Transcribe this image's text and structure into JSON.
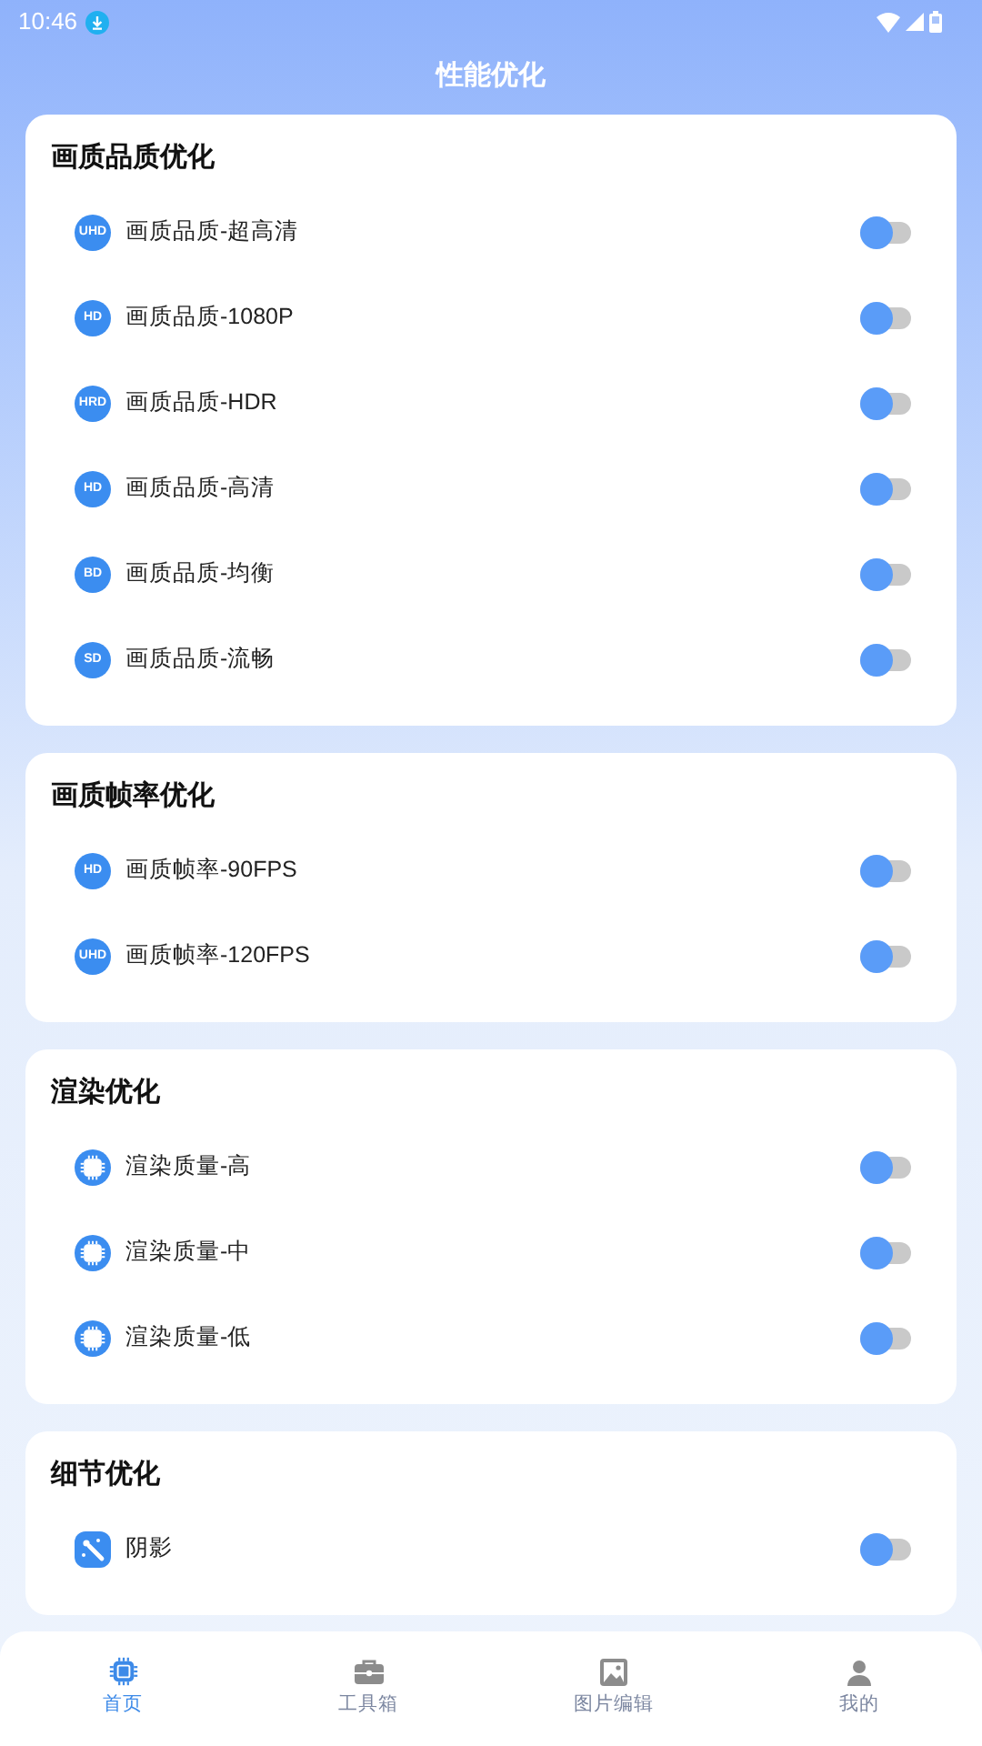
{
  "status_bar": {
    "time": "10:46"
  },
  "header": {
    "title": "性能优化"
  },
  "sections": [
    {
      "title": "画质品质优化",
      "items": [
        {
          "kind": "badge",
          "badge": "UHD",
          "label": "画质品质-超高清",
          "on": false
        },
        {
          "kind": "badge",
          "badge": "HD",
          "label": "画质品质-1080P",
          "on": false
        },
        {
          "kind": "badge",
          "badge": "HRD",
          "label": "画质品质-HDR",
          "on": false
        },
        {
          "kind": "badge",
          "badge": "HD",
          "label": "画质品质-高清",
          "on": false
        },
        {
          "kind": "badge",
          "badge": "BD",
          "label": "画质品质-均衡",
          "on": false
        },
        {
          "kind": "badge",
          "badge": "SD",
          "label": "画质品质-流畅",
          "on": false
        }
      ]
    },
    {
      "title": "画质帧率优化",
      "items": [
        {
          "kind": "badge",
          "badge": "HD",
          "label": "画质帧率-90FPS",
          "on": false
        },
        {
          "kind": "badge",
          "badge": "UHD",
          "label": "画质帧率-120FPS",
          "on": false
        }
      ]
    },
    {
      "title": "渲染优化",
      "items": [
        {
          "kind": "chip",
          "label": "渲染质量-高",
          "on": false
        },
        {
          "kind": "chip",
          "label": "渲染质量-中",
          "on": false
        },
        {
          "kind": "chip",
          "label": "渲染质量-低",
          "on": false
        }
      ]
    },
    {
      "title": "细节优化",
      "items": [
        {
          "kind": "wand",
          "label": "阴影",
          "on": false
        }
      ]
    }
  ],
  "bottom_nav": [
    {
      "kind": "chip",
      "label": "首页",
      "selected": true
    },
    {
      "kind": "toolbox",
      "label": "工具箱",
      "selected": false
    },
    {
      "kind": "image",
      "label": "图片编辑",
      "selected": false
    },
    {
      "kind": "person",
      "label": "我的",
      "selected": false
    }
  ]
}
